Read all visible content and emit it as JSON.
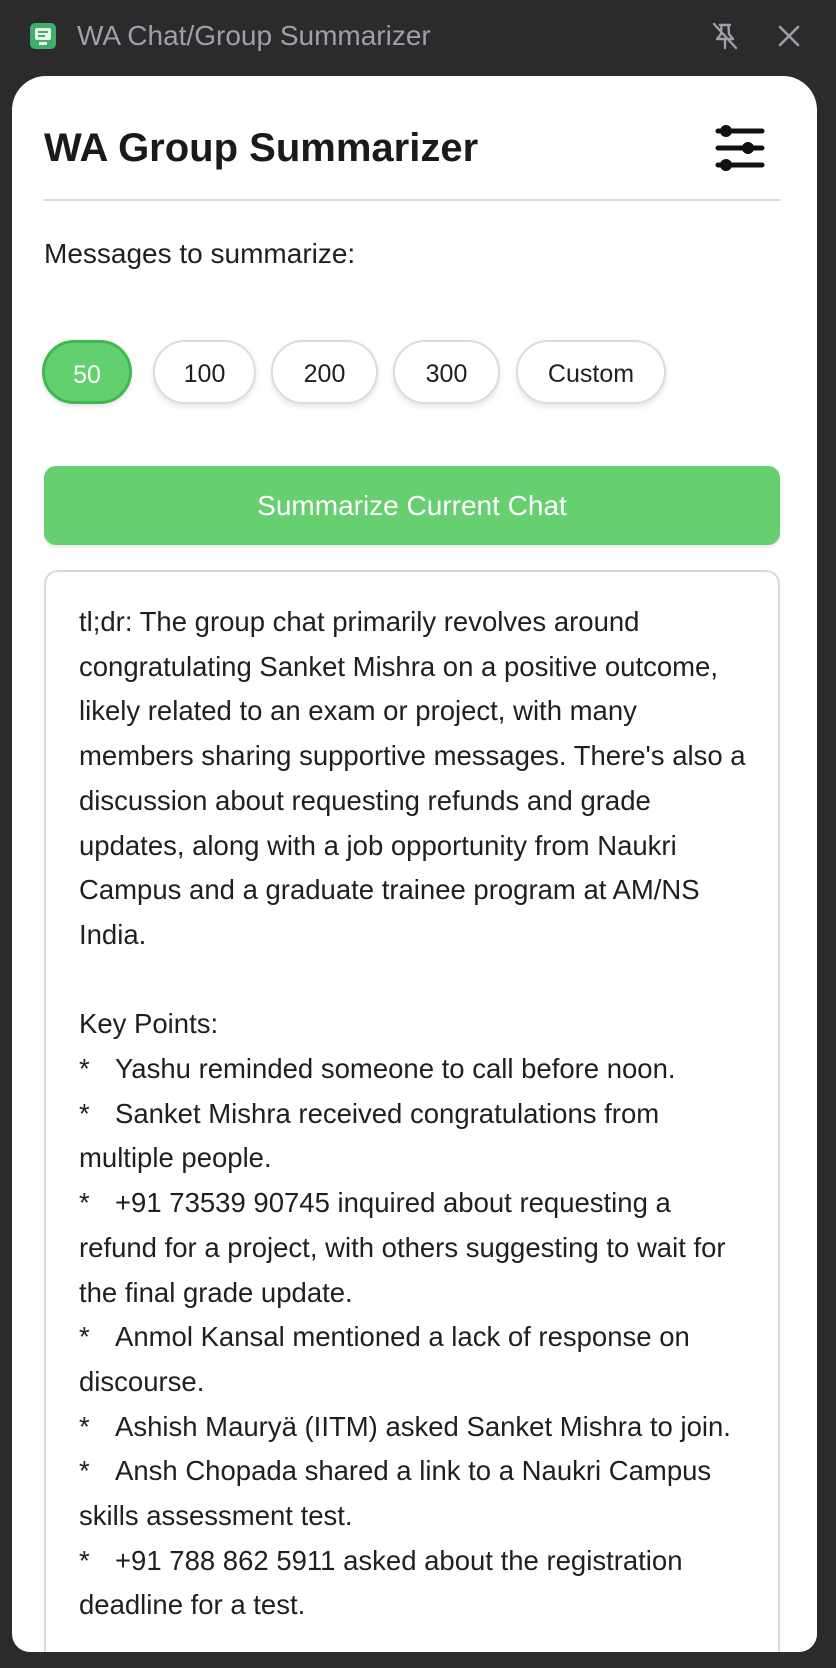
{
  "window": {
    "title": "WA Chat/Group Summarizer",
    "icons": [
      "app-icon",
      "pin-off-icon",
      "close-icon"
    ]
  },
  "header": {
    "title": "WA Group Summarizer",
    "settings_icon": "sliders-icon"
  },
  "messages": {
    "label": "Messages to summarize:",
    "options": [
      "50",
      "100",
      "200",
      "300",
      "Custom"
    ],
    "selected": "50"
  },
  "summarize_button": "Summarize Current Chat",
  "summary": {
    "tldr": "tl;dr: The group chat primarily revolves around congratulating Sanket Mishra on a positive outcome, likely related to an exam or project, with many members sharing supportive messages. There's also a discussion about requesting refunds and grade updates, along with a job opportunity from Naukri Campus and a graduate trainee program at AM/NS India.",
    "key_points_heading": "Key Points:",
    "bullet_marker": "*",
    "points": [
      "Yashu reminded someone to call before noon.",
      "Sanket Mishra received congratulations from multiple people.",
      "+91 73539 90745 inquired about requesting a refund for a project, with others suggesting to wait for the final grade update.",
      "Anmol Kansal mentioned a lack of response on discourse.",
      "Ashish Mauryä (IITM) asked Sanket Mishra to join.",
      "Ansh Chopada shared a link to a Naukri Campus skills assessment test.",
      "+91 788 862 5911 asked about the registration deadline for a test."
    ]
  },
  "colors": {
    "accent": "#66cf70",
    "accent_border": "#3fb84f",
    "titlebar": "#2b2b2d",
    "panel": "#ffffff"
  }
}
